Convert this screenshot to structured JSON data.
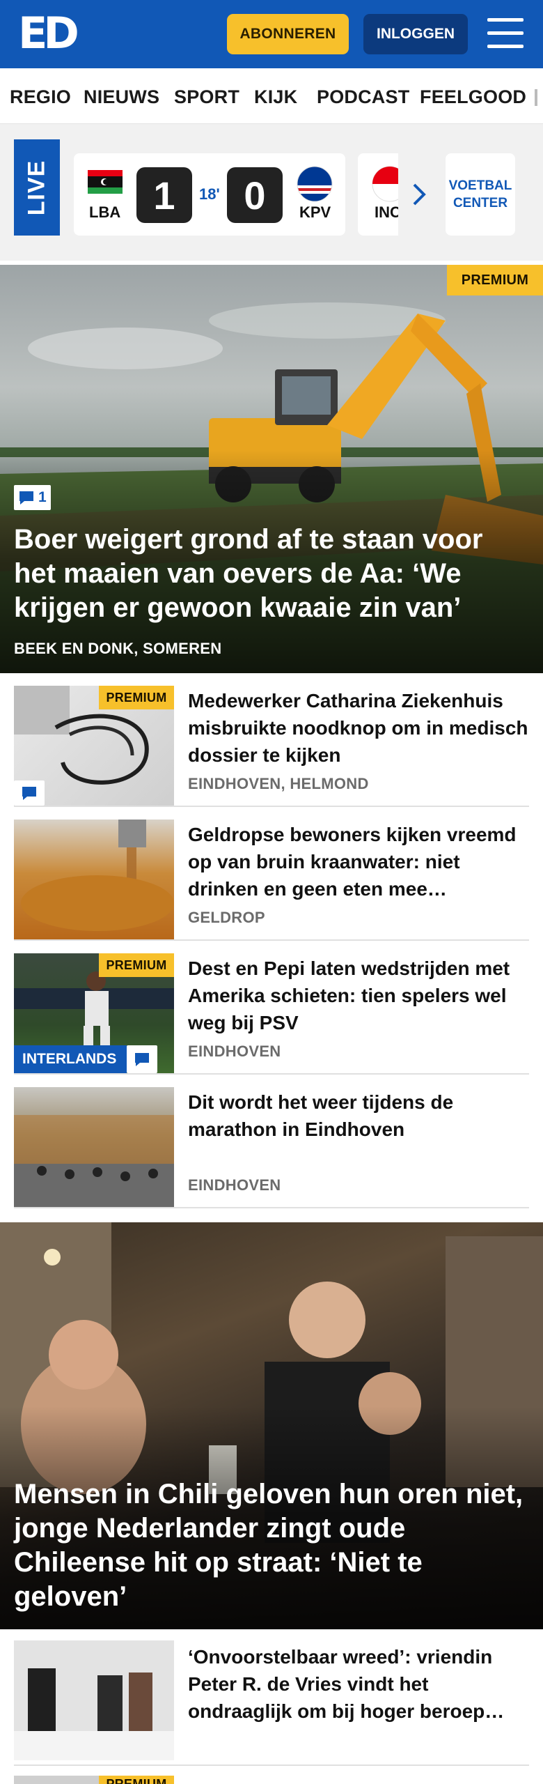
{
  "header": {
    "logo_text": "ED",
    "subscribe_label": "ABONNEREN",
    "login_label": "INLOGGEN",
    "menu_icon": "hamburger-menu-icon",
    "colors": {
      "brand_blue": "#1158b6",
      "premium_yellow": "#f7c02b",
      "login_navy": "#0c3a7e"
    }
  },
  "nav": {
    "items": [
      "REGIO",
      "NIEUWS",
      "SPORT",
      "KIJK",
      "PODCAST",
      "FEELGOOD"
    ]
  },
  "live": {
    "badge": "LIVE",
    "match": {
      "home_team": "LBA",
      "away_team": "KPV",
      "home_score": "1",
      "away_score": "0",
      "minute": "18'"
    },
    "next_match_team": "INC",
    "center_label": "VOETBAL CENTER"
  },
  "hero": {
    "premium": "PREMIUM",
    "comments": "1",
    "title": "Boer weigert grond af te staan voor het maaien van oevers de Aa: ‘We krijgen er gewoon kwaaie zin van’",
    "location": "BEEK EN DONK, SOMEREN"
  },
  "articles": [
    {
      "premium": "PREMIUM",
      "title": "Medewerker Catharina Ziekenhuis misbruikte noodknop om in medisch dossier te kijken",
      "location": "EINDHOVEN, HELMOND"
    },
    {
      "title": "Geldropse bewoners kijken vreemd op van bruin kraanwater: niet drinken en geen eten mee…",
      "location": "GELDROP"
    },
    {
      "premium": "PREMIUM",
      "tag": "INTERLANDS",
      "title": "Dest en Pepi laten wedstrijden met Amerika schieten: tien spelers wel weg bij PSV",
      "location": "EINDHOVEN"
    },
    {
      "title": "Dit wordt het weer tijdens de marathon in Eindhoven",
      "location": "EINDHOVEN"
    }
  ],
  "video_hero": {
    "title": "Mensen in Chili geloven hun oren niet, jonge Nederlander zingt oude Chileense hit op straat: ‘Niet te geloven’"
  },
  "last_article": {
    "title": "‘Onvoorstelbaar wreed’: vriendin Peter R. de Vries vindt het ondraaglijk om bij hoger beroep…"
  },
  "next_strip": {
    "premium": "PREMIUM"
  }
}
